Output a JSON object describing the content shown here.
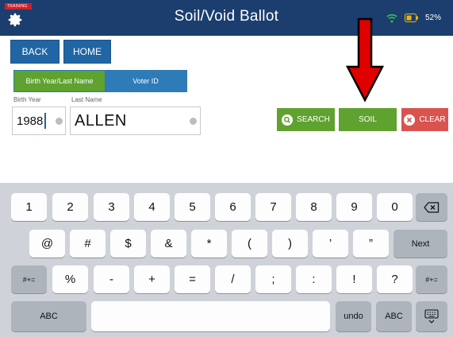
{
  "status_bar": {
    "training_label": "TRAINING",
    "title": "Soil/Void Ballot",
    "battery_percent": "52%"
  },
  "nav": {
    "back_label": "BACK",
    "home_label": "HOME"
  },
  "search_mode_tabs": [
    {
      "label": "Birth Year/Last Name",
      "selected": true
    },
    {
      "label": "Voter ID",
      "selected": false
    }
  ],
  "form": {
    "birth_year_label": "Birth Year",
    "birth_year_value": "1988",
    "last_name_label": "Last Name",
    "last_name_value": "ALLEN"
  },
  "actions": {
    "search_label": "SEARCH",
    "soil_label": "SOIL",
    "clear_label": "CLEAR"
  },
  "keyboard": {
    "row1": [
      "1",
      "2",
      "3",
      "4",
      "5",
      "6",
      "7",
      "8",
      "9",
      "0"
    ],
    "row2": [
      "@",
      "#",
      "$",
      "&",
      "*",
      "(",
      ")",
      "’",
      "”"
    ],
    "next_label": "Next",
    "row3_toggle": "#+=",
    "row3": [
      "%",
      "-",
      "+",
      "=",
      "/",
      ";",
      ":",
      "!",
      "?"
    ],
    "abc_label": "ABC",
    "undo_label": "undo"
  },
  "colors": {
    "header": "#1b3e6e",
    "primary_blue": "#2166a4",
    "green": "#5fa22f",
    "red": "#d9534f",
    "training_red": "#d0202a",
    "arrow_red": "#e00000"
  },
  "icons": [
    "gear-icon",
    "wifi-icon",
    "battery-icon",
    "search-icon",
    "clear-x-icon",
    "backspace-icon",
    "keyboard-hide-icon"
  ]
}
